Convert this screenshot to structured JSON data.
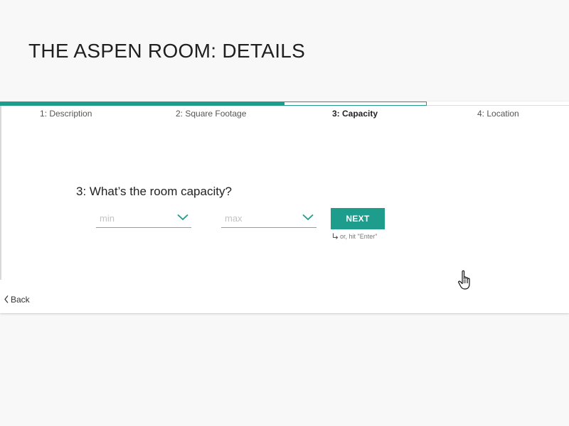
{
  "page": {
    "title": "THE ASPEN ROOM: DETAILS"
  },
  "progress": {
    "completed_fraction": 0.5,
    "current_step_fraction": 0.25
  },
  "steps": [
    {
      "label": "1: Description",
      "active": false
    },
    {
      "label": "2: Square Footage",
      "active": false
    },
    {
      "label": "3: Capacity",
      "active": true
    },
    {
      "label": "4: Location",
      "active": false
    }
  ],
  "form": {
    "question": "3: What’s the room capacity?",
    "min_select": {
      "placeholder": "min",
      "value": ""
    },
    "max_select": {
      "placeholder": "max",
      "value": ""
    },
    "next_label": "NEXT",
    "hint": "or, hit \"Enter\""
  },
  "navigation": {
    "back_label": "Back"
  },
  "icons": {
    "chevron": "chevron-down-icon",
    "back": "chevron-left-icon",
    "enter": "return-arrow-icon",
    "cursor": "hand-pointer-icon"
  },
  "colors": {
    "accent": "#1e9c8c",
    "background": "#f8f8f8",
    "panel": "#ffffff"
  }
}
